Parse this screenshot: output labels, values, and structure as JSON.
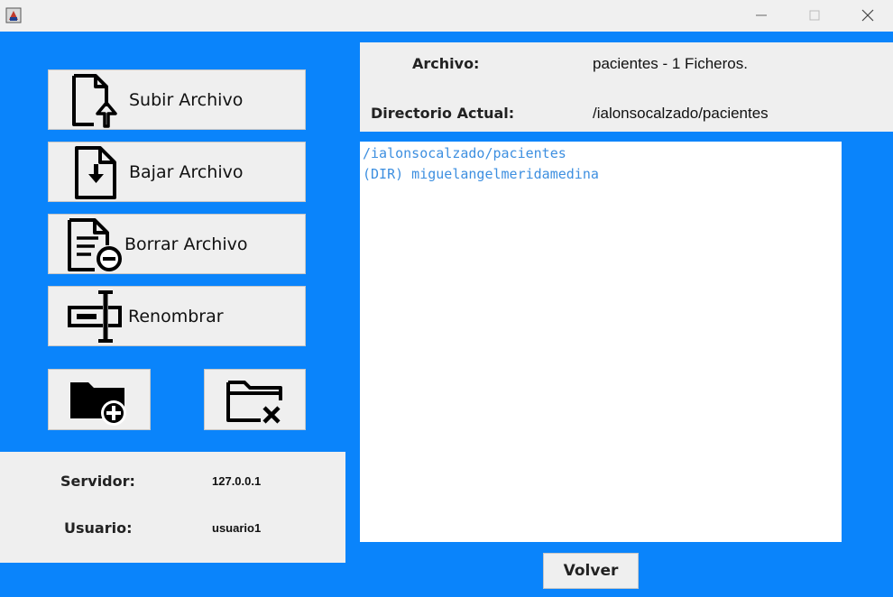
{
  "titlebar": {
    "app_icon": "java-cup-icon",
    "controls": [
      "minimize-icon",
      "maximize-icon",
      "close-icon"
    ]
  },
  "sidebar": {
    "upload_label": "Subir Archivo",
    "download_label": "Bajar Archivo",
    "delete_label": "Borrar Archivo",
    "rename_label": "Renombrar",
    "new_folder_icon": "folder-add-icon",
    "delete_folder_icon": "folder-delete-icon"
  },
  "connection": {
    "server_label": "Servidor:",
    "server_value": "127.0.0.1",
    "user_label": "Usuario:",
    "user_value": "usuario1"
  },
  "header": {
    "file_label": "Archivo:",
    "file_value": "pacientes - 1 Ficheros.",
    "dir_label": "Directorio Actual:",
    "dir_value": "/ialonsocalzado/pacientes"
  },
  "listing": {
    "items": [
      "/ialonsocalzado/pacientes",
      "(DIR) miguelangelmeridamedina"
    ],
    "text_color": "#3d8fe0"
  },
  "footer": {
    "back_label": "Volver"
  },
  "colors": {
    "background": "#0a84fb",
    "panel": "#efefef"
  }
}
